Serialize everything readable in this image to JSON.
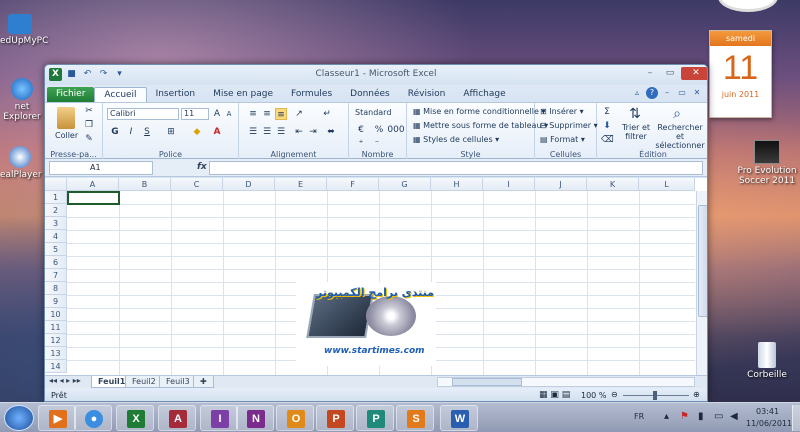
{
  "desktop": {
    "icons": [
      {
        "label": "edUpMyPC"
      },
      {
        "label": "net Explorer"
      },
      {
        "label": "ealPlayer"
      },
      {
        "label": "Pro Evolution Soccer 2011"
      },
      {
        "label": "Corbeille"
      }
    ],
    "calendar": {
      "weekday": "samedi",
      "day": "11",
      "month_year": "juin 2011"
    }
  },
  "window": {
    "title": "Classeur1  -  Microsoft Excel",
    "tabs": [
      "Fichier",
      "Accueil",
      "Insertion",
      "Mise en page",
      "Formules",
      "Données",
      "Révision",
      "Affichage"
    ],
    "active_tab": "Accueil"
  },
  "ribbon": {
    "clipboard": {
      "paste": "Coller",
      "label": "Presse-pa..."
    },
    "font": {
      "name": "Calibri",
      "size": "11",
      "bold": "G",
      "italic": "I",
      "underline": "S",
      "label": "Police"
    },
    "alignment": {
      "label": "Alignement"
    },
    "number": {
      "format": "Standard",
      "percent": "%",
      "thousands": "000",
      "label": "Nombre"
    },
    "style": {
      "conditional": "Mise en forme conditionnelle",
      "table": "Mettre sous forme de tableau",
      "cell_styles": "Styles de cellules",
      "label": "Style"
    },
    "cells": {
      "insert": "Insérer",
      "delete": "Supprimer",
      "format": "Format",
      "label": "Cellules"
    },
    "editing": {
      "sort": "Trier et filtrer",
      "find": "Rechercher et sélectionner",
      "label": "Édition"
    }
  },
  "formula_bar": {
    "name_box": "A1",
    "fx": "fx",
    "content": ""
  },
  "grid": {
    "columns": [
      "A",
      "B",
      "C",
      "D",
      "E",
      "F",
      "G",
      "H",
      "I",
      "J",
      "K",
      "L"
    ],
    "rows": [
      "1",
      "2",
      "3",
      "4",
      "5",
      "6",
      "7",
      "8",
      "9",
      "10",
      "11",
      "12",
      "13",
      "14"
    ]
  },
  "sheets": {
    "tabs": [
      "Feuil1",
      "Feuil2",
      "Feuil3"
    ],
    "active": "Feuil1"
  },
  "status": {
    "ready": "Prêt",
    "zoom": "100 %"
  },
  "watermark": {
    "text": "منتدى برامج الكمبيوتر",
    "url": "www.startimes.com"
  },
  "taskbar": {
    "apps": [
      {
        "name": "media-player",
        "letter": "▶",
        "color": "#e26f1a"
      },
      {
        "name": "chrome",
        "letter": "●",
        "color": "#3b8de0"
      },
      {
        "name": "excel",
        "letter": "X",
        "color": "#1f7c35"
      },
      {
        "name": "access",
        "letter": "A",
        "color": "#a52a3a"
      },
      {
        "name": "infopath",
        "letter": "I",
        "color": "#7b3fa6"
      },
      {
        "name": "onenote",
        "letter": "N",
        "color": "#7a2b8c"
      },
      {
        "name": "outlook",
        "letter": "O",
        "color": "#e08a1a"
      },
      {
        "name": "powerpoint",
        "letter": "P",
        "color": "#c4481f"
      },
      {
        "name": "publisher",
        "letter": "P",
        "color": "#1f8a79"
      },
      {
        "name": "sharepoint",
        "letter": "S",
        "color": "#e07a1a"
      },
      {
        "name": "word",
        "letter": "W",
        "color": "#2a5fb0"
      }
    ],
    "lang": "FR",
    "time": "03:41",
    "date": "11/06/2011"
  }
}
